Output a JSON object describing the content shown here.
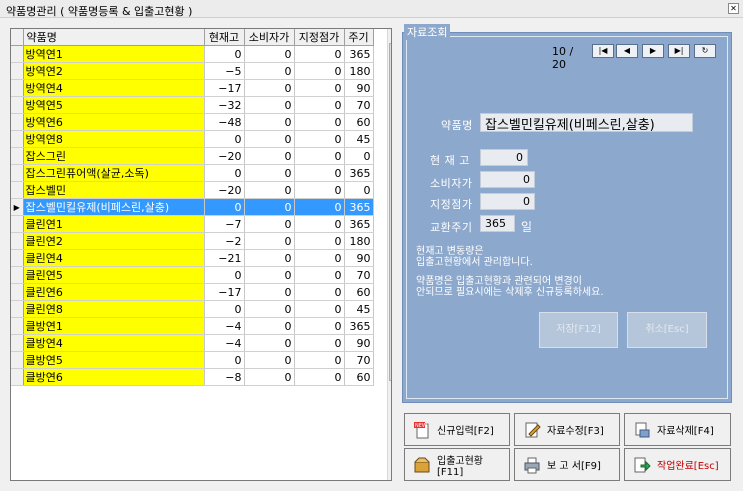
{
  "window": {
    "title": "약품명관리 ( 약품명등록 & 입출고현황 )",
    "close_glyph": "✕"
  },
  "grid": {
    "columns": [
      "약품명",
      "현재고",
      "소비자가",
      "지정점가",
      "주기"
    ],
    "rows": [
      [
        "방역연1",
        "0",
        "0",
        "0",
        "365"
      ],
      [
        "방역연2",
        "−5",
        "0",
        "0",
        "180"
      ],
      [
        "방역연4",
        "−17",
        "0",
        "0",
        "90"
      ],
      [
        "방역연5",
        "−32",
        "0",
        "0",
        "70"
      ],
      [
        "방역연6",
        "−48",
        "0",
        "0",
        "60"
      ],
      [
        "방역연8",
        "0",
        "0",
        "0",
        "45"
      ],
      [
        "잡스그린",
        "−20",
        "0",
        "0",
        "0"
      ],
      [
        "잡스그린퓨어액(살균,소독)",
        "0",
        "0",
        "0",
        "365"
      ],
      [
        "잡스벨민",
        "−20",
        "0",
        "0",
        "0"
      ],
      [
        "잡스벨민킬유제(비페스린,살충)",
        "0",
        "0",
        "0",
        "365"
      ],
      [
        "클린연1",
        "−7",
        "0",
        "0",
        "365"
      ],
      [
        "클린연2",
        "−2",
        "0",
        "0",
        "180"
      ],
      [
        "클린연4",
        "−21",
        "0",
        "0",
        "90"
      ],
      [
        "클린연5",
        "0",
        "0",
        "0",
        "70"
      ],
      [
        "클린연6",
        "−17",
        "0",
        "0",
        "60"
      ],
      [
        "클린연8",
        "0",
        "0",
        "0",
        "45"
      ],
      [
        "클방연1",
        "−4",
        "0",
        "0",
        "365"
      ],
      [
        "클방연4",
        "−4",
        "0",
        "0",
        "90"
      ],
      [
        "클방연5",
        "0",
        "0",
        "0",
        "70"
      ],
      [
        "클방연6",
        "−8",
        "0",
        "0",
        "60"
      ]
    ],
    "selected_index": 9,
    "row_indicator_glyph": "▶"
  },
  "panel": {
    "group_label": "자료조회",
    "page_indicator": "10 / 20",
    "nav_glyphs": [
      "|◀",
      "◀",
      "▶",
      "▶|",
      "↻"
    ],
    "name_label": "약품명",
    "name_value": "잡스벨민킬유제(비페스린,살충)",
    "stock_label": "현 재 고",
    "stock_value": "0",
    "price_label": "소비자가",
    "price_value": "0",
    "dealer_label": "지정점가",
    "dealer_value": "0",
    "cycle_label": "교환주기",
    "cycle_value": "365",
    "cycle_unit": "일",
    "note1_line1": "현재고 변동량은",
    "note1_line2": "입출고현황에서 관리합니다.",
    "note2_line1": "약품명은 입출고현황과 관련되어 변경이",
    "note2_line2": "안되므로 필요시에는 삭제후 신규등록하세요.",
    "save_label": "저장[F12]",
    "cancel_label": "취소[Esc]"
  },
  "actions": {
    "new_label": "신규입력[F2]",
    "edit_label": "자료수정[F3]",
    "delete_label": "자료삭제[F4]",
    "inout_label": "입출고현황[F11]",
    "report_label": "보 고 서[F9]",
    "done_label": "작업완료[Esc]"
  },
  "colors": {
    "panel_bg": "#8ca8cc",
    "name_highlight": "#ffff00",
    "selection": "#3399ff",
    "done_text": "#c00000"
  }
}
